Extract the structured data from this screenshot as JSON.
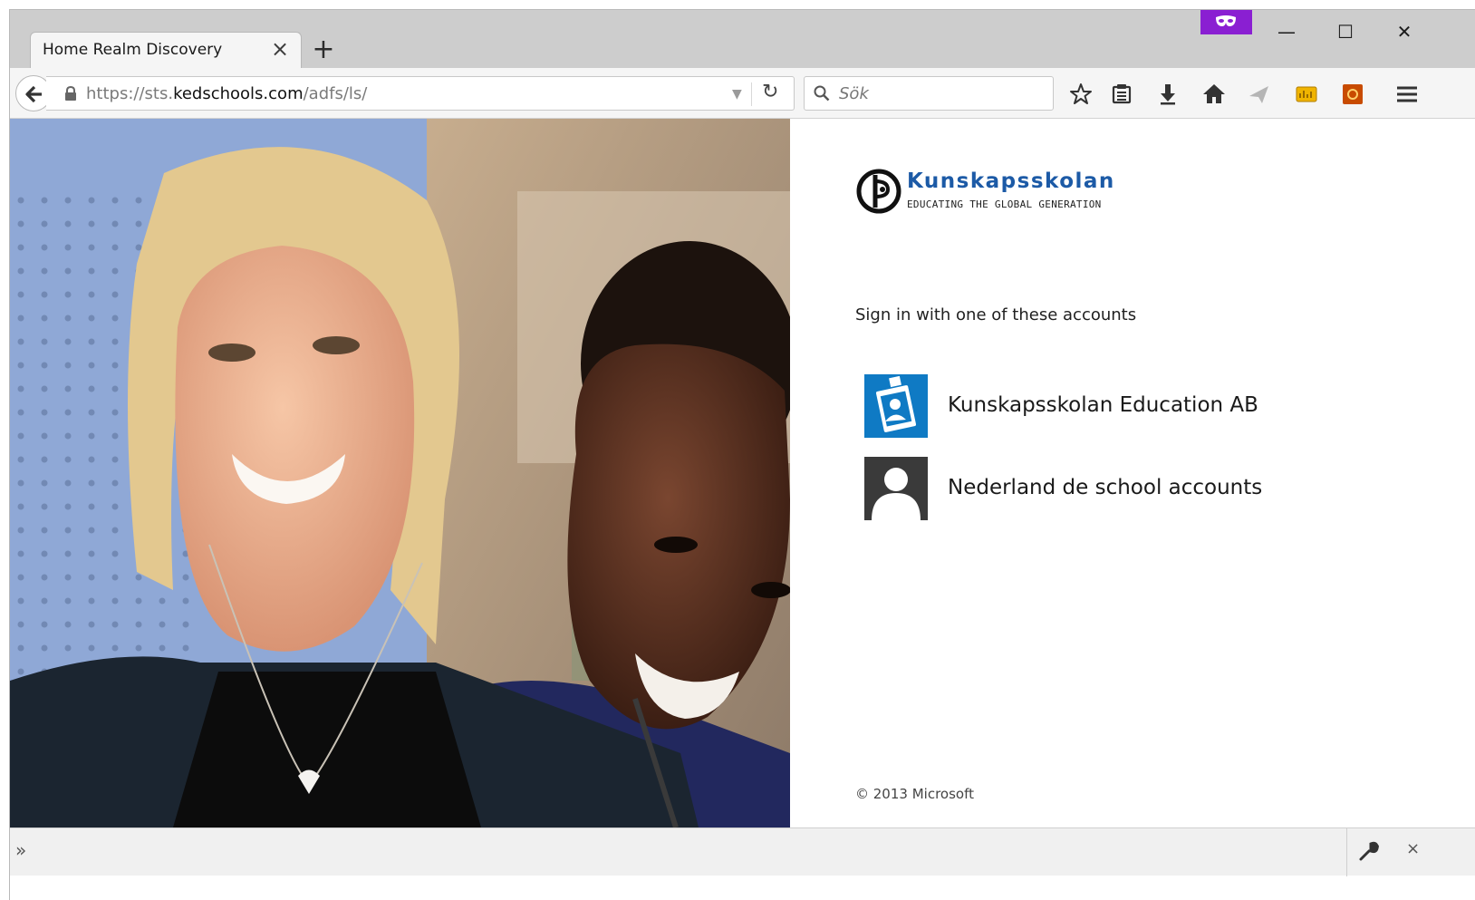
{
  "tab": {
    "title": "Home Realm Discovery",
    "close": "×",
    "new_tab": "+"
  },
  "window_controls": {
    "minimize": "—",
    "maximize": "☐",
    "close": "✕"
  },
  "navbar": {
    "url_prefix": "https://sts.",
    "url_host": "kedschools.com",
    "url_path": "/adfs/ls/",
    "dropmarker": "▼",
    "reload": "↻",
    "search_placeholder": "Sök",
    "toolbar_icons": [
      "bookmark-star-icon",
      "reading-list-icon",
      "download-icon",
      "home-icon",
      "send-tab-icon",
      "extension-yellow-icon",
      "extension-orange-icon",
      "menu-icon"
    ]
  },
  "logo": {
    "name": "Kunskapsskolan",
    "tagline": "EDUCATING THE GLOBAL GENERATION"
  },
  "signin": {
    "intro": "Sign in with one of these accounts",
    "providers": [
      {
        "label": "Kunskapsskolan Education AB",
        "icon": "id-badge-icon",
        "color": "#0f7ac4"
      },
      {
        "label": "Nederland de school accounts",
        "icon": "generic-user-icon",
        "color": "#3a3a3a"
      }
    ]
  },
  "footer": {
    "copyright": "© 2013 Microsoft"
  },
  "statusbar": {
    "chevron": "»",
    "close": "×"
  },
  "colors": {
    "private_badge": "#8a1fd2",
    "logo_blue": "#1c5aa6"
  }
}
